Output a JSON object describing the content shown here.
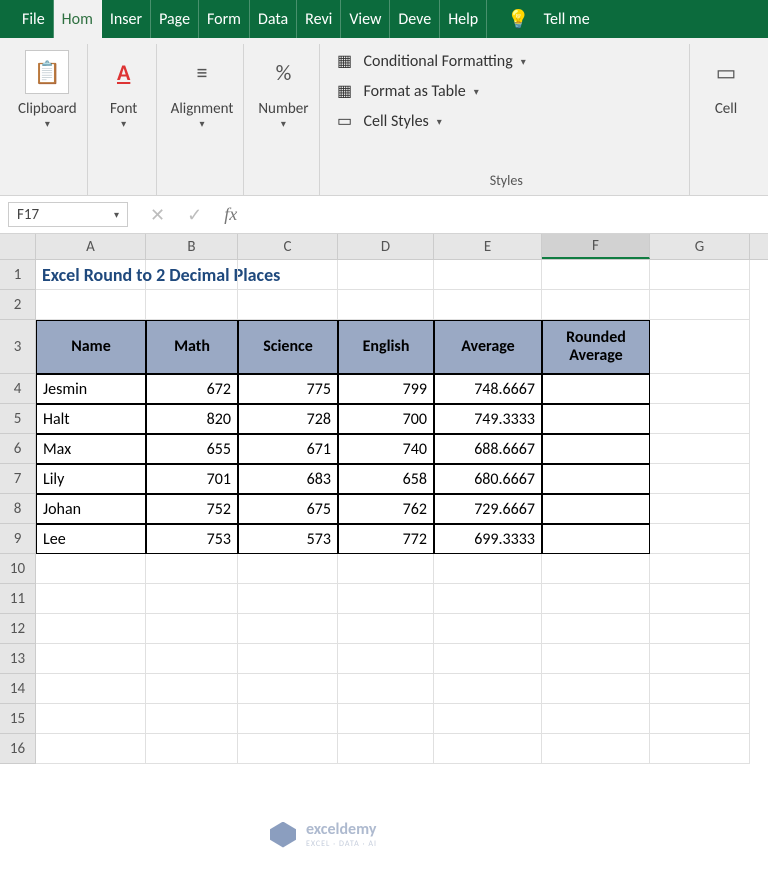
{
  "tabs": {
    "file": "File",
    "home": "Hom",
    "insert": "Inser",
    "page": "Page",
    "formulas": "Form",
    "data": "Data",
    "review": "Revi",
    "view": "View",
    "developer": "Deve",
    "help": "Help"
  },
  "tellme": "Tell me",
  "ribbon": {
    "clipboard": {
      "label": "Clipboard",
      "icon": "📋"
    },
    "font": {
      "label": "Font",
      "icon": "A"
    },
    "alignment": {
      "label": "Alignment",
      "icon": "≡"
    },
    "number": {
      "label": "Number",
      "icon": "%"
    },
    "styles": {
      "label": "Styles",
      "conditional": "Conditional Formatting",
      "table": "Format as Table",
      "cellstyles": "Cell Styles"
    },
    "cells": {
      "label": "Cell"
    }
  },
  "formula_bar": {
    "namebox": "F17",
    "fx": "fx",
    "value": ""
  },
  "columns": [
    "A",
    "B",
    "C",
    "D",
    "E",
    "F",
    "G"
  ],
  "title_cell": "Excel Round to 2 Decimal Places",
  "headers": {
    "name": "Name",
    "math": "Math",
    "science": "Science",
    "english": "English",
    "average": "Average",
    "rounded": "Rounded Average"
  },
  "data_rows": [
    {
      "name": "Jesmin",
      "math": "672",
      "science": "775",
      "english": "799",
      "average": "748.6667",
      "rounded": ""
    },
    {
      "name": "Halt",
      "math": "820",
      "science": "728",
      "english": "700",
      "average": "749.3333",
      "rounded": ""
    },
    {
      "name": "Max",
      "math": "655",
      "science": "671",
      "english": "740",
      "average": "688.6667",
      "rounded": ""
    },
    {
      "name": "Lily",
      "math": "701",
      "science": "683",
      "english": "658",
      "average": "680.6667",
      "rounded": ""
    },
    {
      "name": "Johan",
      "math": "752",
      "science": "675",
      "english": "762",
      "average": "729.6667",
      "rounded": ""
    },
    {
      "name": "Lee",
      "math": "753",
      "science": "573",
      "english": "772",
      "average": "699.3333",
      "rounded": ""
    }
  ],
  "row_numbers": [
    "1",
    "2",
    "3",
    "4",
    "5",
    "6",
    "7",
    "8",
    "9",
    "10",
    "11",
    "12",
    "13",
    "14",
    "15",
    "16"
  ],
  "watermark": {
    "brand": "exceldemy",
    "tagline": "EXCEL · DATA · AI"
  }
}
